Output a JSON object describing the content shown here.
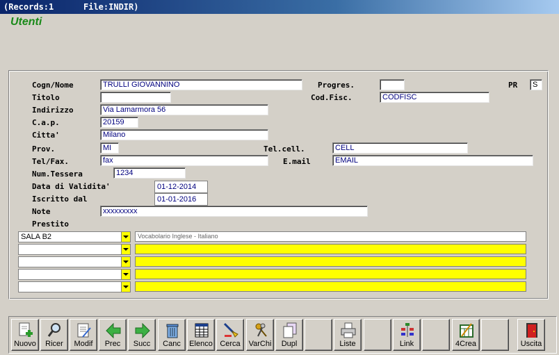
{
  "titlebar": {
    "records": "(Records:1",
    "file": "File:INDIR)"
  },
  "app_title": "Utenti",
  "labels": {
    "cognome": "Cogn/Nome",
    "titolo": "Titolo",
    "indirizzo": "Indirizzo",
    "cap": "C.a.p.",
    "citta": "Citta'",
    "prov": "Prov.",
    "telfax": "Tel/Fax.",
    "numtessera": "Num.Tessera",
    "datavalidita": "Data di Validita'",
    "iscritto": "Iscritto dal",
    "note": "Note",
    "prestito": "Prestito",
    "progres": "Progres.",
    "pr": "PR",
    "codfisc": "Cod.Fisc.",
    "telcell": "Tel.cell.",
    "email": "E.mail"
  },
  "fields": {
    "cognome": "TRULLI GIOVANNINO",
    "titolo": "",
    "indirizzo": "Via Lamarmora 56",
    "cap": "20159",
    "citta": "Milano",
    "prov": "MI",
    "telfax": "fax",
    "numtessera": "1234",
    "datavalidita": "01-12-2014",
    "iscritto": "01-01-2016",
    "note": "xxxxxxxxx",
    "progres": "",
    "pr": "S",
    "codfisc": "CODFISC",
    "telcell": "CELL",
    "email": "EMAIL"
  },
  "prestiti": [
    {
      "sala": "SALA B2",
      "desc": "Vocabolario Inglese - Italiano"
    },
    {
      "sala": "",
      "desc": ""
    },
    {
      "sala": "",
      "desc": ""
    },
    {
      "sala": "",
      "desc": ""
    },
    {
      "sala": "",
      "desc": ""
    }
  ],
  "toolbar": {
    "nuovo": "Nuovo",
    "ricer": "Ricer",
    "modif": "Modif",
    "prec": "Prec",
    "succ": "Succ",
    "canc": "Canc",
    "elenco": "Elenco",
    "cerca": "Cerca",
    "varchi": "VarChi",
    "dupl": "Dupl",
    "liste": "Liste",
    "link": "Link",
    "crea": "4Crea",
    "uscita": "Uscita"
  },
  "colors": {
    "title_green": "#1a8a1a",
    "field_text": "#00007f",
    "highlight_yellow": "#ffff00",
    "titlebar_blue": "#0a246a"
  },
  "icons": [
    "new-record-icon",
    "search-icon",
    "edit-icon",
    "arrow-left-icon",
    "arrow-right-icon",
    "trash-icon",
    "table-icon",
    "find-icon",
    "keys-icon",
    "duplicate-icon",
    "printer-icon",
    "link-icon",
    "create-icon",
    "exit-door-icon"
  ]
}
